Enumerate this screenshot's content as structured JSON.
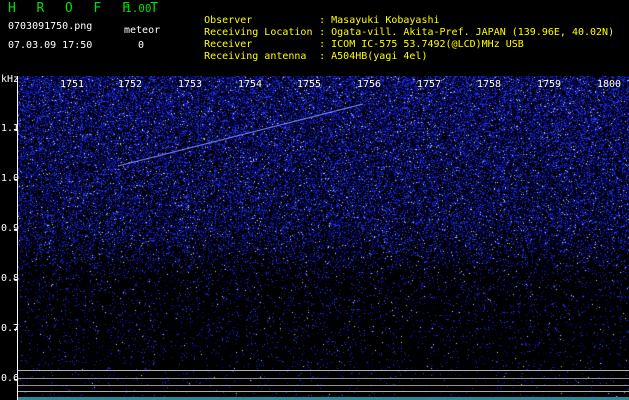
{
  "header": {
    "app_title": "HROFFT",
    "app_version": "1.00",
    "filename": "0703091750.png",
    "datetime": "07.03.09 17:50",
    "meteor_label": "meteor",
    "meteor_count": "0",
    "info": [
      {
        "key": "Observer",
        "value": ": Masayuki Kobayashi"
      },
      {
        "key": "Receiving Location",
        "value": ": Ogata-vill. Akita-Pref. JAPAN (139.96E, 40.02N)"
      },
      {
        "key": "Receiver",
        "value": ": ICOM IC-575 53.7492(@LCD)MHz USB"
      },
      {
        "key": "Receiving antenna",
        "value": ": A504HB(yagi 4el)"
      }
    ]
  },
  "spectrogram": {
    "y_unit": "kHz",
    "y_ticks": [
      "1.1",
      "1.0",
      "0.9",
      "0.8",
      "0.7",
      "0.6"
    ],
    "x_ticks": [
      "1751",
      "1752",
      "1753",
      "1754",
      "1755",
      "1756",
      "1757",
      "1758",
      "1759",
      "1800"
    ],
    "colors": {
      "noise": "#3040ff",
      "trail": "#8090ff",
      "text": "#ffff00",
      "title": "#00e000"
    }
  }
}
